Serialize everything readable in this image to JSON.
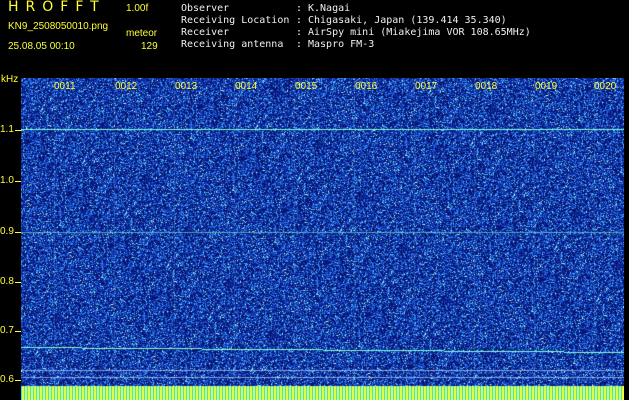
{
  "header": {
    "title": "HROFFT",
    "version": "1.00f",
    "file_name": "KN9_2508050010.png",
    "mode": "meteor",
    "date_time": "25.08.05 00:10",
    "count": "129"
  },
  "station_info": [
    {
      "label": "Observer",
      "value": "K.Nagai"
    },
    {
      "label": "Receiving Location",
      "value": "Chigasaki, Japan (139.414 35.340)"
    },
    {
      "label": "Receiver",
      "value": "AirSpy mini (Miakejima VOR 108.65MHz)"
    },
    {
      "label": "Receiving antenna",
      "value": "Maspro FM-3"
    }
  ],
  "separator": ":",
  "spectrogram": {
    "y_unit": "kHz",
    "y_ticks": [
      "1.1",
      "1.0",
      "0.9",
      "0.8",
      "0.7",
      "0.6"
    ],
    "x_ticks": [
      "0011",
      "0012",
      "0013",
      "0014",
      "0015",
      "0016",
      "0017",
      "0018",
      "0019",
      "0020"
    ],
    "colors": {
      "background": "#0a1a80",
      "noise": "#4a8cff",
      "signal": "#7fffd4",
      "axis": "#ffff33"
    }
  }
}
